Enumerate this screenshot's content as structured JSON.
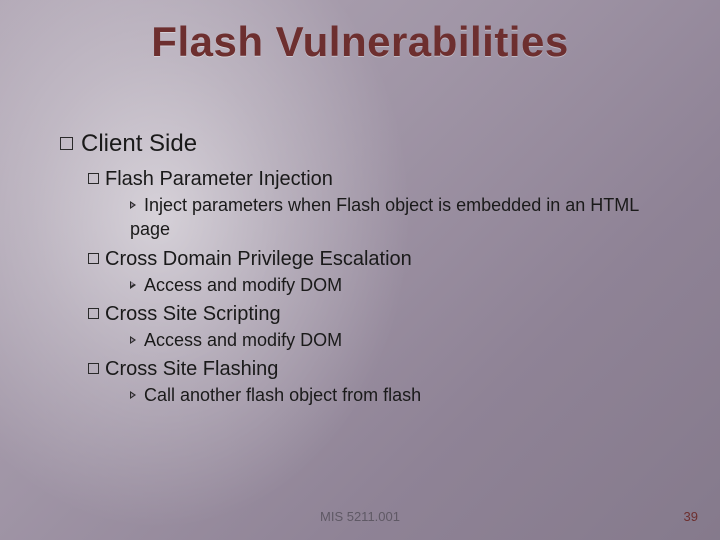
{
  "title": "Flash Vulnerabilities",
  "lvl1": "Client Side",
  "items": [
    {
      "h": "Flash Parameter Injection",
      "d": "Inject parameters when Flash object is embedded in an HTML page"
    },
    {
      "h": "Cross Domain Privilege Escalation",
      "d": "Access and modify DOM"
    },
    {
      "h": "Cross Site Scripting",
      "d": "Access and modify DOM"
    },
    {
      "h": "Cross Site Flashing",
      "d": "Call another flash object from flash"
    }
  ],
  "footer": {
    "course": "MIS 5211.001",
    "page": "39"
  }
}
